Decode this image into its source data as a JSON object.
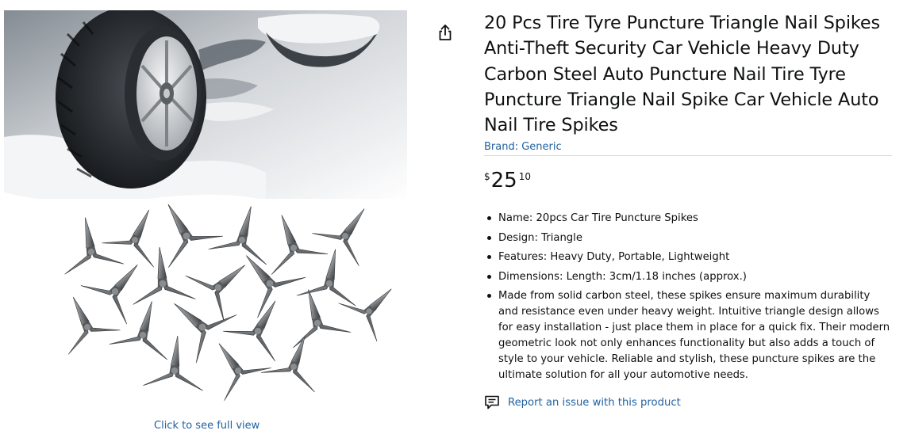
{
  "image": {
    "alt": "Tire with triangle nail spikes",
    "click_to_view": "Click to see full view"
  },
  "share": {
    "icon": "share-icon"
  },
  "product": {
    "title": "20 Pcs Tire Tyre Puncture Triangle Nail Spikes Anti-Theft Security Car Vehicle Heavy Duty Carbon Steel Auto Puncture Nail Tire Tyre Puncture Triangle Nail Spike Car Vehicle Auto Nail Tire Spikes",
    "brand": "Brand: Generic",
    "price": {
      "symbol": "$",
      "whole": "25",
      "fraction": "10"
    },
    "features": [
      "Name: 20pcs Car Tire Puncture Spikes",
      "Design: Triangle",
      "Features: Heavy Duty, Portable, Lightweight",
      "Dimensions: Length: 3cm/1.18 inches (approx.)",
      "Made from solid carbon steel, these spikes ensure maximum durability and resistance even under heavy weight. Intuitive triangle design allows for easy installation - just place them in place for a quick fix. Their modern geometric look not only enhances functionality but also adds a touch of style to your vehicle. Reliable and stylish, these puncture spikes are the ultimate solution for all your automotive needs."
    ],
    "report_issue": "Report an issue with this product"
  },
  "colors": {
    "link": "#2162a1",
    "text": "#0f1111",
    "divider": "#d5d9d9"
  }
}
